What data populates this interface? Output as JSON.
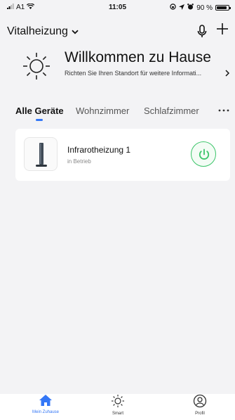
{
  "status_bar": {
    "carrier": "A1",
    "time": "11:05",
    "battery": "90 %",
    "battery_level": 0.9
  },
  "header": {
    "home_name": "Vitalheizung"
  },
  "welcome": {
    "title": "Willkommen zu Hause",
    "subtitle": "Richten Sie Ihren Standort für weitere Informati..."
  },
  "tabs": [
    {
      "label": "Alle Geräte",
      "active": true
    },
    {
      "label": "Wohnzimmer",
      "active": false
    },
    {
      "label": "Schlafzimmer",
      "active": false
    }
  ],
  "devices": [
    {
      "name": "Infrarotheizung 1",
      "status": "in Betrieb"
    }
  ],
  "bottom_nav": [
    {
      "label": "Mein Zuhause",
      "icon": "home-icon",
      "active": true
    },
    {
      "label": "Smart",
      "icon": "sun-icon",
      "active": false
    },
    {
      "label": "Profil",
      "icon": "profile-icon",
      "active": false
    }
  ],
  "colors": {
    "accent": "#3477f6",
    "power_green": "#3cc56a"
  }
}
